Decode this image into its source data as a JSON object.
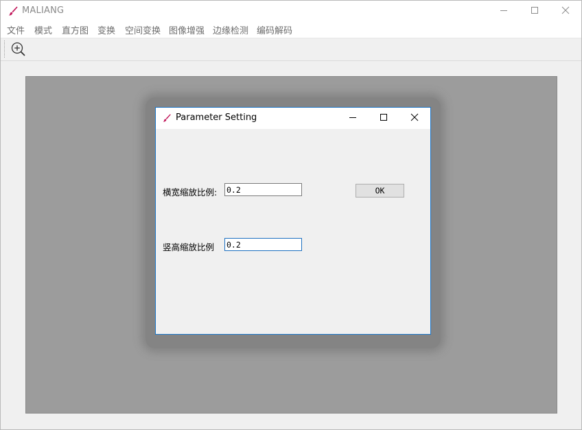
{
  "app": {
    "title": "MALIANG",
    "controls": {
      "minimize": "minimize-icon",
      "maximize": "maximize-icon",
      "close": "close-icon"
    }
  },
  "menu": {
    "items": [
      "文件",
      "模式",
      "直方图",
      "变换",
      "空间变换",
      "图像增强",
      "边缘检测",
      "编码解码"
    ]
  },
  "toolbar": {
    "tools": [
      {
        "icon": "zoom-in-icon"
      }
    ]
  },
  "dialog": {
    "title": "Parameter Setting",
    "fields": [
      {
        "label": "横宽缩放比例:",
        "value": "0.2"
      },
      {
        "label": "竖高缩放比例",
        "value": "0.2"
      }
    ],
    "ok_label": "OK"
  },
  "colors": {
    "accent": "#1a76c9",
    "icon_brush": "#c2185b",
    "canvas": "#9c9c9c",
    "window_bg": "#f0f0f0"
  }
}
